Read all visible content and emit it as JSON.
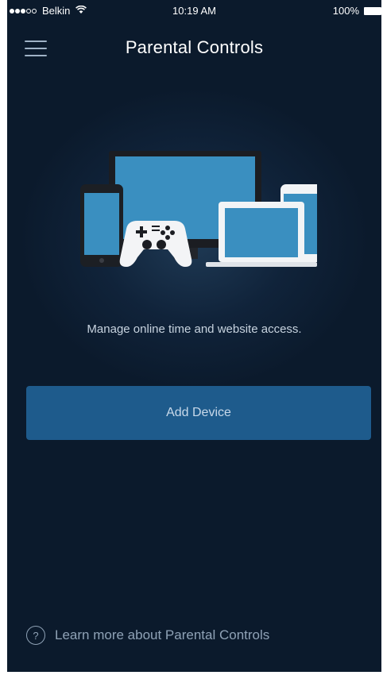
{
  "status_bar": {
    "carrier": "Belkin",
    "time": "10:19 AM",
    "battery": "100%"
  },
  "nav": {
    "title": "Parental Controls"
  },
  "main": {
    "description": "Manage online time and website access.",
    "add_device_label": "Add Device"
  },
  "footer": {
    "help_glyph": "?",
    "learn_more_label": "Learn more about Parental Controls"
  },
  "colors": {
    "background": "#10233a",
    "button": "#1e5b8c",
    "device_screen": "#3a8fc0"
  }
}
